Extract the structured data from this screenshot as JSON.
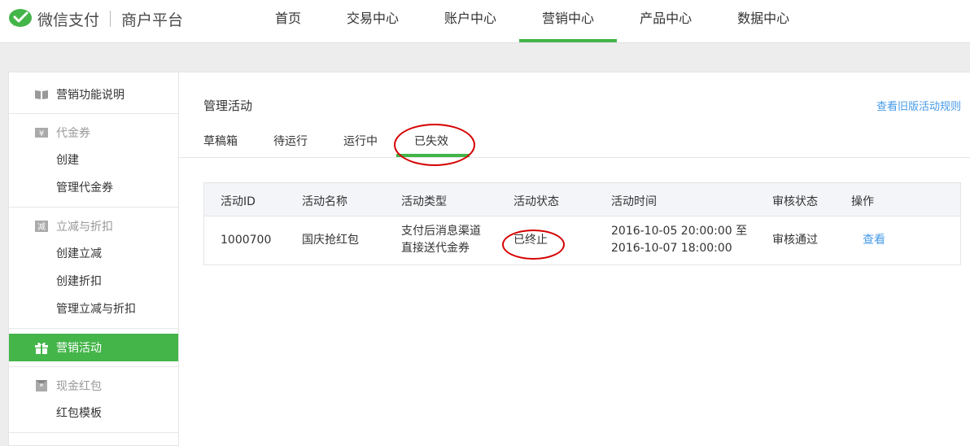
{
  "header": {
    "logo_text": "微信支付",
    "logo_sub": "商户平台",
    "nav": [
      "首页",
      "交易中心",
      "账户中心",
      "营销中心",
      "产品中心",
      "数据中心"
    ],
    "active_nav": "营销中心"
  },
  "sidebar": {
    "item_intro": "营销功能说明",
    "coupon": {
      "title": "代金券",
      "items": [
        "创建",
        "管理代金券"
      ]
    },
    "discount": {
      "title": "立减与折扣",
      "items": [
        "创建立减",
        "创建折扣",
        "管理立减与折扣"
      ]
    },
    "activity": "营销活动",
    "redpacket": {
      "title": "现金红包",
      "items": [
        "红包模板"
      ]
    }
  },
  "main": {
    "title": "管理活动",
    "old_rules_link": "查看旧版活动规则",
    "tabs": [
      "草稿箱",
      "待运行",
      "运行中",
      "已失效"
    ],
    "active_tab": "已失效",
    "table": {
      "headers": [
        "活动ID",
        "活动名称",
        "活动类型",
        "活动状态",
        "活动时间",
        "审核状态",
        "操作"
      ],
      "rows": [
        {
          "id": "1000700",
          "name": "国庆抢红包",
          "type_line1": "支付后消息渠道",
          "type_line2": "直接送代金券",
          "status": "已终止",
          "time_line1": "2016-10-05 20:00:00 至",
          "time_line2": "2016-10-07 18:00:00",
          "review": "审核通过",
          "action": "查看"
        }
      ]
    }
  },
  "colors": {
    "brand_green": "#44b549",
    "link_blue": "#459ae9",
    "annotation_red": "#d60000"
  },
  "icons": [
    "wechat-pay-logo-icon",
    "book-icon",
    "yen-icon",
    "minus-badge-icon",
    "gift-icon",
    "redpacket-icon"
  ]
}
